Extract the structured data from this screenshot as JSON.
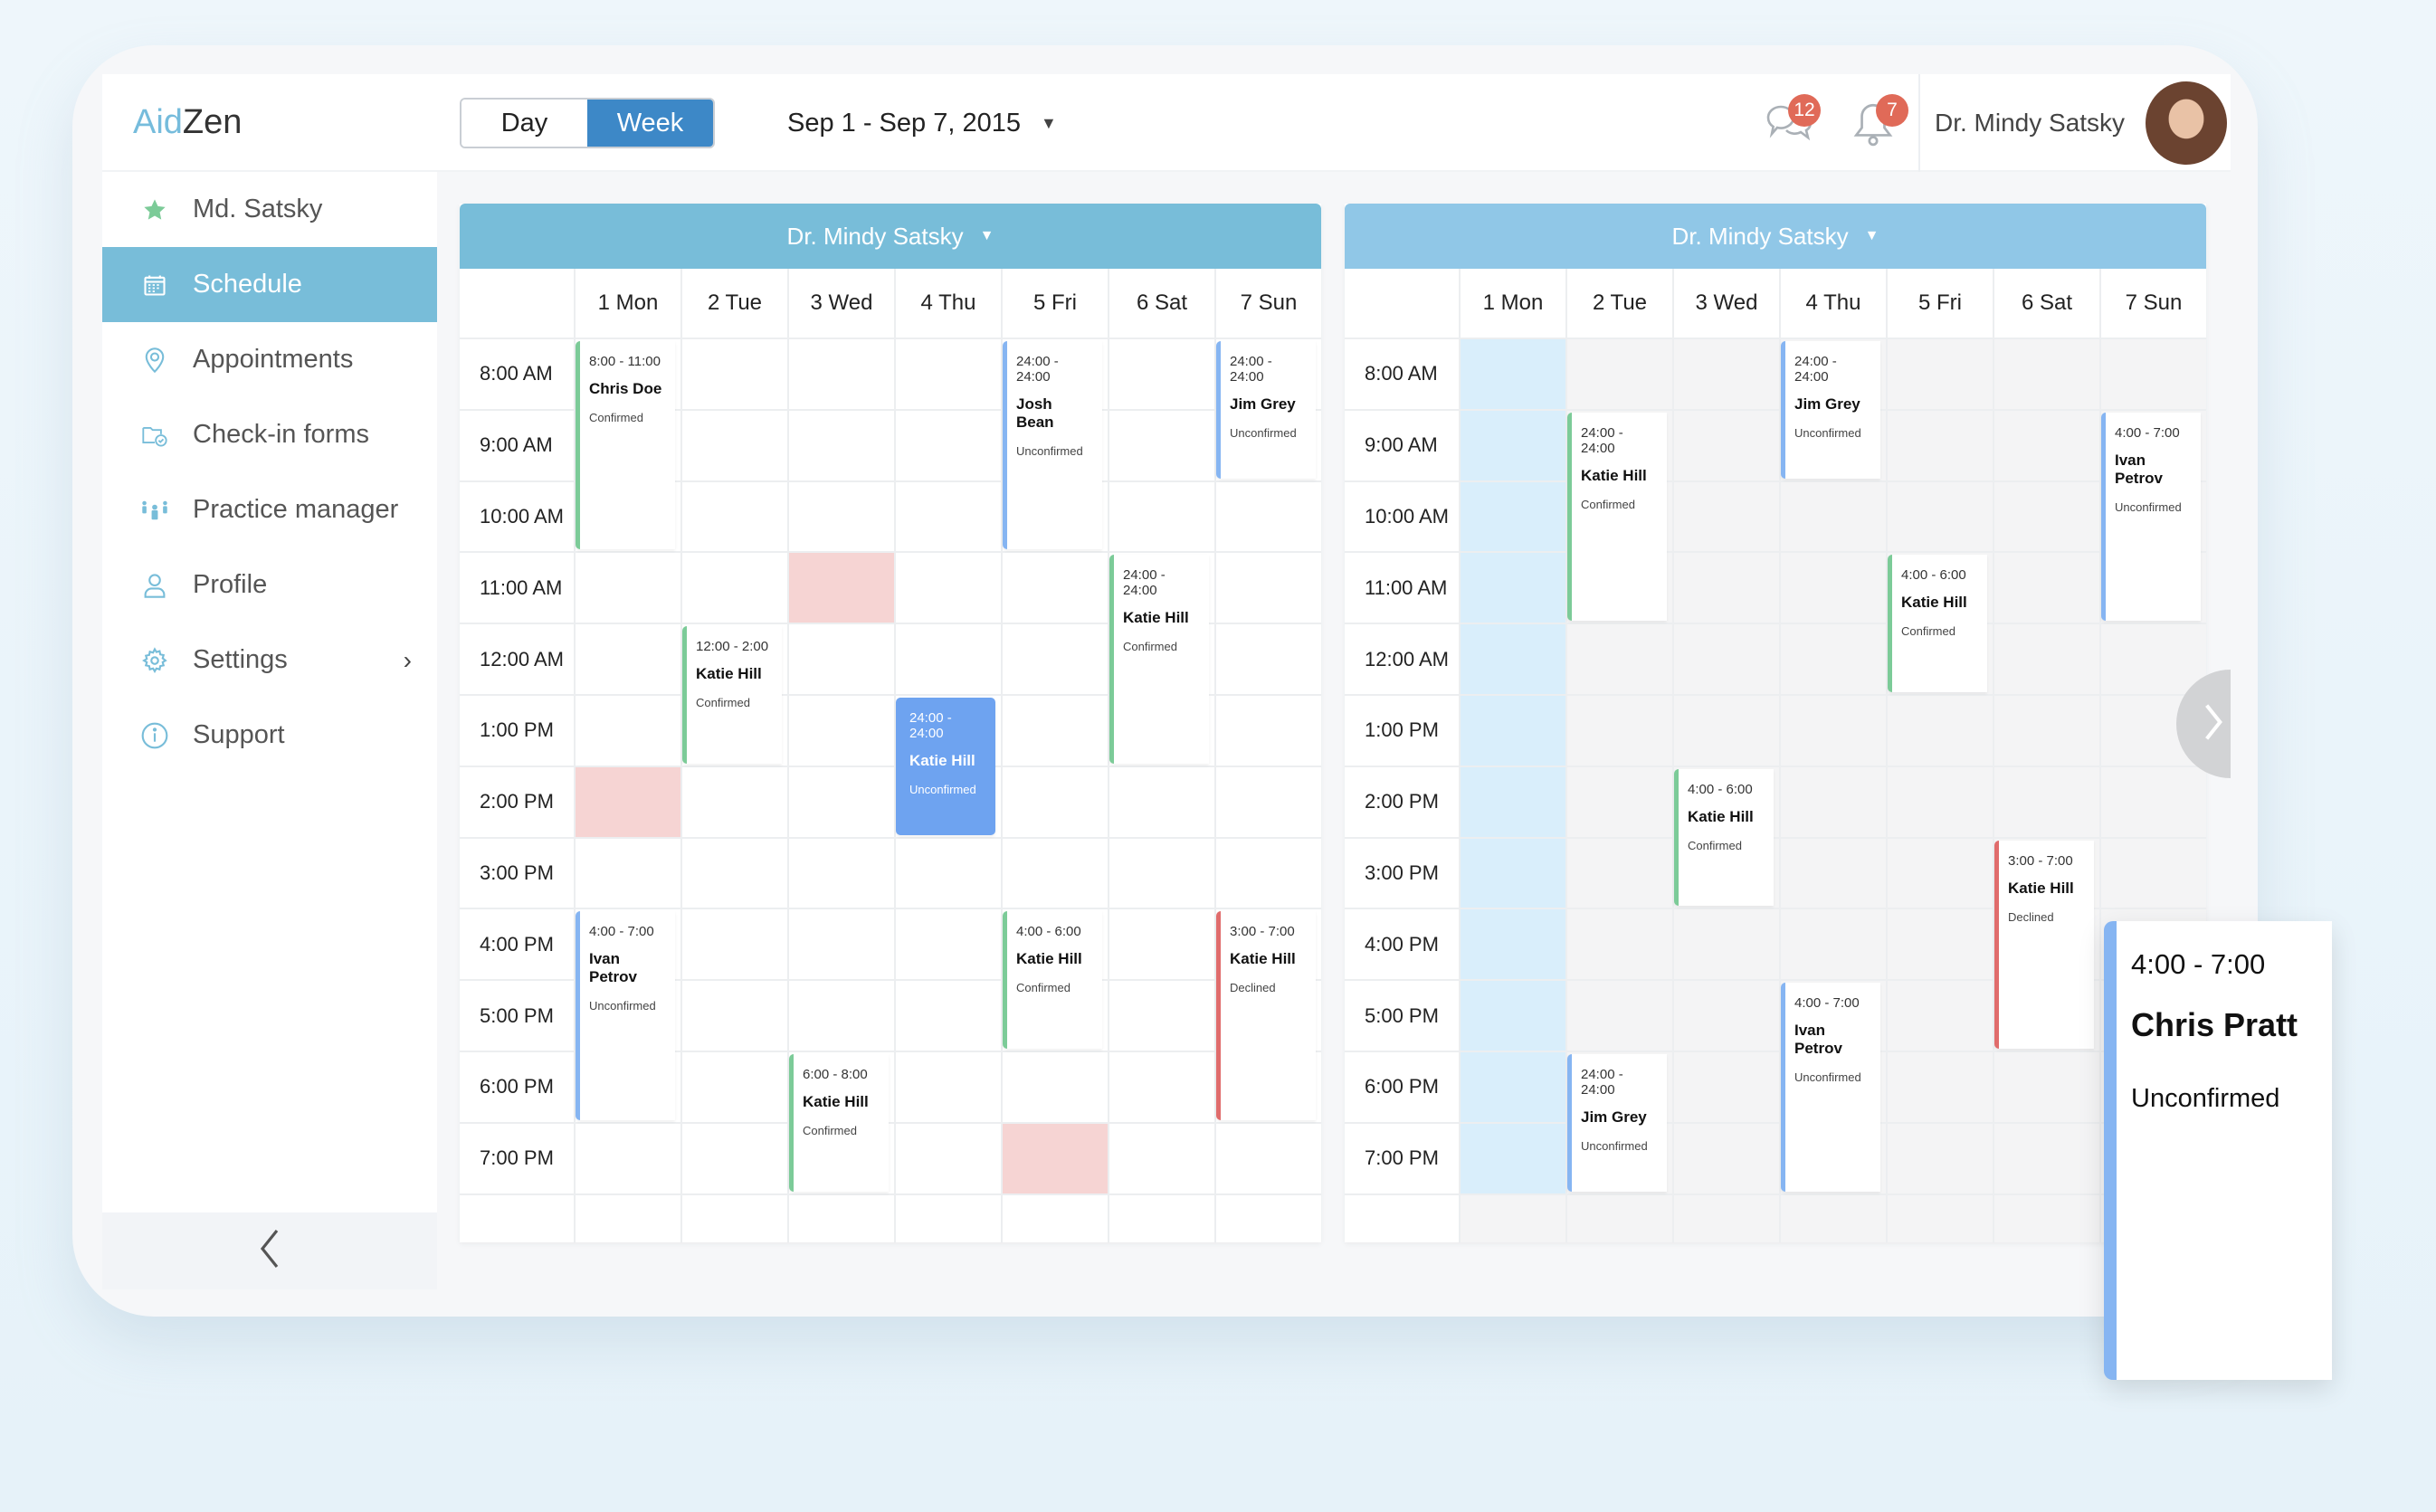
{
  "app": {
    "logo_part1": "Aid",
    "logo_part2": "Zen"
  },
  "sidebar": {
    "items": [
      {
        "label": "Md. Satsky",
        "icon": "star-icon",
        "active": false
      },
      {
        "label": "Schedule",
        "icon": "calendar-icon",
        "active": true
      },
      {
        "label": "Appointments",
        "icon": "location-pin-icon",
        "active": false
      },
      {
        "label": "Check-in forms",
        "icon": "folder-check-icon",
        "active": false
      },
      {
        "label": "Practice manager",
        "icon": "people-group-icon",
        "active": false
      },
      {
        "label": "Profile",
        "icon": "user-icon",
        "active": false
      },
      {
        "label": "Settings",
        "icon": "gear-icon",
        "active": false,
        "has_submenu": true
      },
      {
        "label": "Support",
        "icon": "info-icon",
        "active": false
      }
    ],
    "collapse_icon": "chevron-left-icon"
  },
  "header": {
    "view_toggle": {
      "day_label": "Day",
      "week_label": "Week",
      "selected": "Week"
    },
    "date_range": "Sep 1 - Sep 7, 2015",
    "messages_count": "12",
    "notifications_count": "7",
    "user_name": "Dr. Mindy Satsky"
  },
  "colors": {
    "accent": "#78bdd9",
    "toggle_active": "#3d88c7",
    "confirmed": "#7ccb98",
    "unconfirmed": "#86b5f2",
    "declined": "#e06c6c",
    "blocked": "#f6d4d3",
    "badge": "#e06a58"
  },
  "calendars": [
    {
      "doctor": "Dr. Mindy Satsky",
      "days": [
        "1 Mon",
        "2 Tue",
        "3 Wed",
        "4 Thu",
        "5 Fri",
        "6 Sat",
        "7 Sun"
      ],
      "hours": [
        "8:00 AM",
        "9:00 AM",
        "10:00 AM",
        "11:00 AM",
        "12:00 AM",
        "1:00 PM",
        "2:00 PM",
        "3:00 PM",
        "4:00 PM",
        "5:00 PM",
        "6:00 PM",
        "7:00 PM"
      ],
      "blocked": [
        {
          "day": 2,
          "hour": 3
        },
        {
          "day": 0,
          "hour": 6
        },
        {
          "day": 4,
          "hour": 11
        }
      ],
      "events": [
        {
          "day": 0,
          "start": 0,
          "span": 3,
          "time": "8:00 - 11:00",
          "name": "Chris Doe",
          "status": "Confirmed",
          "color": "green"
        },
        {
          "day": 4,
          "start": 0,
          "span": 3,
          "time": "24:00 - 24:00",
          "name": "Josh Bean",
          "status": "Unconfirmed",
          "color": "blue"
        },
        {
          "day": 6,
          "start": 0,
          "span": 2,
          "time": "24:00 - 24:00",
          "name": "Jim Grey",
          "status": "Unconfirmed",
          "color": "blue"
        },
        {
          "day": 5,
          "start": 3,
          "span": 3,
          "time": "24:00 - 24:00",
          "name": "Katie Hill",
          "status": "Confirmed",
          "color": "green"
        },
        {
          "day": 1,
          "start": 4,
          "span": 2,
          "time": "12:00 - 2:00",
          "name": "Katie Hill",
          "status": "Confirmed",
          "color": "green"
        },
        {
          "day": 3,
          "start": 5,
          "span": 2,
          "time": "24:00 - 24:00",
          "name": "Katie Hill",
          "status": "Unconfirmed",
          "color": "filled"
        },
        {
          "day": 0,
          "start": 8,
          "span": 3,
          "time": "4:00 - 7:00",
          "name": "Ivan Petrov",
          "status": "Unconfirmed",
          "color": "blue"
        },
        {
          "day": 4,
          "start": 8,
          "span": 2,
          "time": "4:00 - 6:00",
          "name": "Katie Hill",
          "status": "Confirmed",
          "color": "green"
        },
        {
          "day": 6,
          "start": 8,
          "span": 3,
          "time": "3:00 - 7:00",
          "name": "Katie Hill",
          "status": "Declined",
          "color": "red"
        },
        {
          "day": 2,
          "start": 10,
          "span": 2,
          "time": "6:00 - 8:00",
          "name": "Katie Hill",
          "status": "Confirmed",
          "color": "green"
        }
      ]
    },
    {
      "doctor": "Dr. Mindy Satsky",
      "days": [
        "1 Mon",
        "2 Tue",
        "3 Wed",
        "4 Thu",
        "5 Fri",
        "6 Sat",
        "7 Sun"
      ],
      "hours": [
        "8:00 AM",
        "9:00 AM",
        "10:00 AM",
        "11:00 AM",
        "12:00 AM",
        "1:00 PM",
        "2:00 PM",
        "3:00 PM",
        "4:00 PM",
        "5:00 PM",
        "6:00 PM",
        "7:00 PM"
      ],
      "today_day": 0,
      "blocked": [],
      "events": [
        {
          "day": 3,
          "start": 0,
          "span": 2,
          "time": "24:00 - 24:00",
          "name": "Jim Grey",
          "status": "Unconfirmed",
          "color": "blue"
        },
        {
          "day": 1,
          "start": 1,
          "span": 3,
          "time": "24:00 - 24:00",
          "name": "Katie Hill",
          "status": "Confirmed",
          "color": "green"
        },
        {
          "day": 6,
          "start": 1,
          "span": 3,
          "time": "4:00 - 7:00",
          "name": "Ivan Petrov",
          "status": "Unconfirmed",
          "color": "blue"
        },
        {
          "day": 4,
          "start": 3,
          "span": 2,
          "time": "4:00 - 6:00",
          "name": "Katie Hill",
          "status": "Confirmed",
          "color": "green"
        },
        {
          "day": 2,
          "start": 6,
          "span": 2,
          "time": "4:00 - 6:00",
          "name": "Katie Hill",
          "status": "Confirmed",
          "color": "green"
        },
        {
          "day": 5,
          "start": 7,
          "span": 3,
          "time": "3:00 - 7:00",
          "name": "Katie Hill",
          "status": "Declined",
          "color": "red"
        },
        {
          "day": 3,
          "start": 9,
          "span": 3,
          "time": "4:00 - 7:00",
          "name": "Ivan Petrov",
          "status": "Unconfirmed",
          "color": "blue"
        },
        {
          "day": 1,
          "start": 10,
          "span": 2,
          "time": "24:00 - 24:00",
          "name": "Jim Grey",
          "status": "Unconfirmed",
          "color": "blue"
        }
      ]
    }
  ],
  "popup": {
    "time": "4:00 - 7:00",
    "name": "Chris Pratt",
    "status": "Unconfirmed"
  },
  "next_icon": "chevron-right-icon"
}
